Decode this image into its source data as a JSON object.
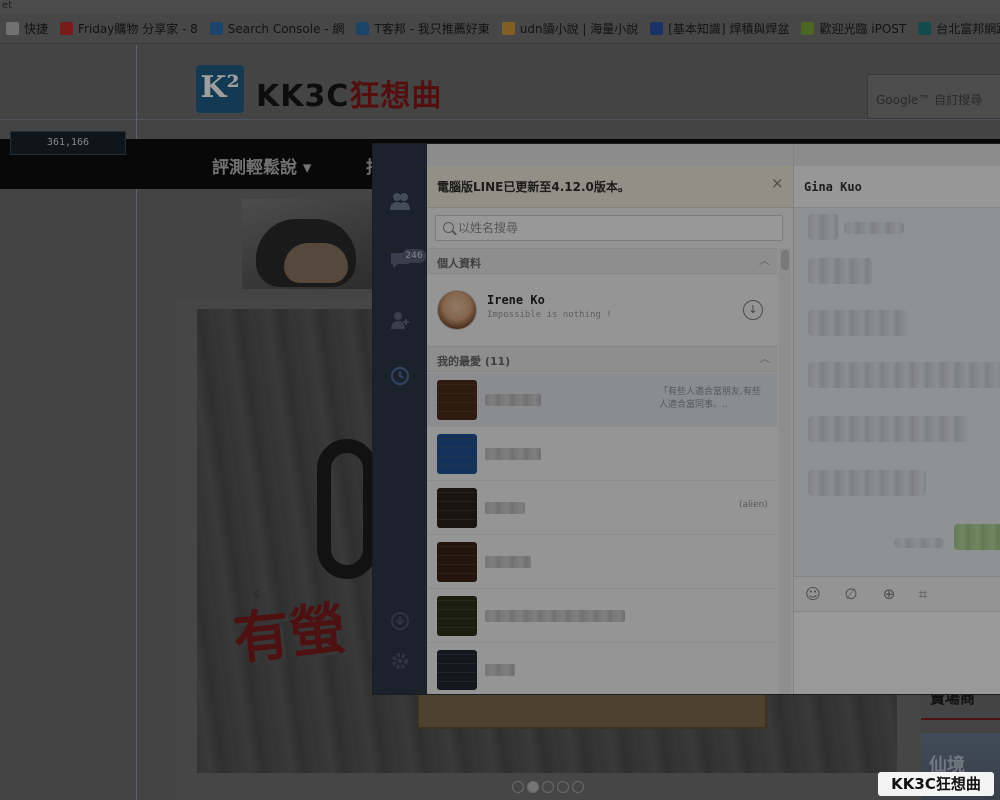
{
  "browser": {
    "title_fragment": "et",
    "bookmarks": [
      {
        "label": "快捷",
        "color": "#b7b7b7"
      },
      {
        "label": "Friday購物 分享家 - 8",
        "color": "#c42d2d"
      },
      {
        "label": "Search Console - 網",
        "color": "#2f6fb0"
      },
      {
        "label": "T客邦 - 我只推薦好東",
        "color": "#2e6fa6"
      },
      {
        "label": "udn讀小說 | 海量小說",
        "color": "#d19a3b"
      },
      {
        "label": "[基本知識] 焊積與焊盆",
        "color": "#2a52a8"
      },
      {
        "label": "歡迎光臨 iPOST",
        "color": "#79a338"
      },
      {
        "label": "台北富邦網路銀",
        "color": "#1f7a78"
      }
    ]
  },
  "site": {
    "logo_letter": "K²",
    "logo_name": "KK3C",
    "logo_name_cn": "狂想曲",
    "google_placeholder": "Google™ 自訂搜尋",
    "counter": "361,166",
    "nav_items": [
      "評測輕鬆說 ▾",
      "拍"
    ],
    "slide_text": "有螢",
    "slide_prev": "‹",
    "slider_dots": 5,
    "slider_active": 1,
    "sidebar_heading": "賣場商",
    "sidebar_thumb_text": "仙境",
    "watermark": "KK3C狂想曲"
  },
  "line": {
    "unread_badge": "246",
    "notice": "電腦版LINE已更新至4.12.0版本。",
    "notice_close": "×",
    "search_placeholder": "以姓名搜尋",
    "sections": {
      "profile_label": "個人資料",
      "favorites_label": "我的最愛 (11)"
    },
    "me": {
      "name": "Irene Ko",
      "status": "Impossible is nothing !"
    },
    "friends": [
      {
        "name_width": 56,
        "color": "#8a6a4a",
        "msg": "「有些人適合當朋友,有些人適合當同事。..",
        "tag": "",
        "selected": true
      },
      {
        "name_width": 56,
        "color": "#5a8fc0",
        "msg": "",
        "tag": "",
        "selected": false
      },
      {
        "name_width": 40,
        "color": "#6a5a4e",
        "msg": "",
        "tag": "(alien)",
        "selected": false
      },
      {
        "name_width": 46,
        "color": "#7a5c48",
        "msg": "",
        "tag": "",
        "selected": false
      },
      {
        "name_width": 140,
        "color": "#6a6f4e",
        "msg": "",
        "tag": "",
        "selected": false
      },
      {
        "name_width": 30,
        "color": "#5c6470",
        "msg": "",
        "tag": "",
        "selected": false
      }
    ],
    "chat": {
      "contact_name": "Gina Kuo"
    }
  }
}
